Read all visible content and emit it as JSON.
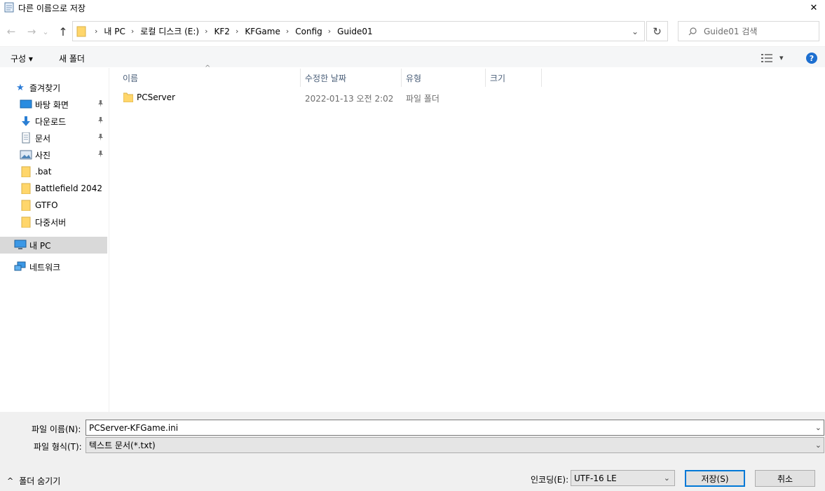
{
  "window": {
    "title": "다른 이름으로 저장",
    "close_symbol": "✕"
  },
  "nav": {
    "back_symbol": "←",
    "forward_symbol": "→",
    "recent_symbol": "⌄",
    "up_symbol": "↑"
  },
  "address": {
    "crumbs": [
      "내 PC",
      "로컬 디스크 (E:)",
      "KF2",
      "KFGame",
      "Config",
      "Guide01"
    ],
    "separator": "›",
    "dropdown_symbol": "⌄",
    "refresh_symbol": "↻"
  },
  "search": {
    "placeholder": "Guide01 검색"
  },
  "toolbar": {
    "organize_label": "구성 ▾",
    "new_folder_label": "새 폴더",
    "view_caret": "▾",
    "help_symbol": "?"
  },
  "sidebar": {
    "quick_access": "즐겨찾기",
    "items": [
      {
        "label": "바탕 화면",
        "icon": "desktop-icon",
        "pinned": true
      },
      {
        "label": "다운로드",
        "icon": "download-icon",
        "pinned": true
      },
      {
        "label": "문서",
        "icon": "document-icon",
        "pinned": true
      },
      {
        "label": "사진",
        "icon": "pictures-icon",
        "pinned": true
      },
      {
        "label": ".bat",
        "icon": "folder-icon",
        "pinned": false
      },
      {
        "label": "Battlefield 2042",
        "icon": "folder-icon",
        "pinned": false
      },
      {
        "label": "GTFO",
        "icon": "folder-icon",
        "pinned": false
      },
      {
        "label": "다중서버",
        "icon": "folder-icon",
        "pinned": false
      }
    ],
    "this_pc": "내 PC",
    "network": "네트워크",
    "pin_symbol": "📌"
  },
  "columns": {
    "name": "이름",
    "modified": "수정한 날짜",
    "type": "유형",
    "size": "크기",
    "sort_symbol": "^"
  },
  "files": [
    {
      "name": "PCServer",
      "modified": "2022-01-13 오전 2:02",
      "type": "파일 폴더",
      "size": ""
    }
  ],
  "form": {
    "filename_label": "파일 이름(N):",
    "filename_value": "PCServer-KFGame.ini",
    "filetype_label": "파일 형식(T):",
    "filetype_value": "텍스트 문서(*.txt)",
    "encoding_label": "인코딩(E):",
    "encoding_value": "UTF-16 LE",
    "caret": "⌄"
  },
  "buttons": {
    "save": "저장(S)",
    "cancel": "취소"
  },
  "hide_folders": {
    "label": "폴더 숨기기",
    "symbol": "^"
  },
  "colors": {
    "accent": "#0078d7",
    "folder": "#ffd66b",
    "selected_bg": "#d9d9d9",
    "bottom_bg": "#f0f0f0"
  }
}
